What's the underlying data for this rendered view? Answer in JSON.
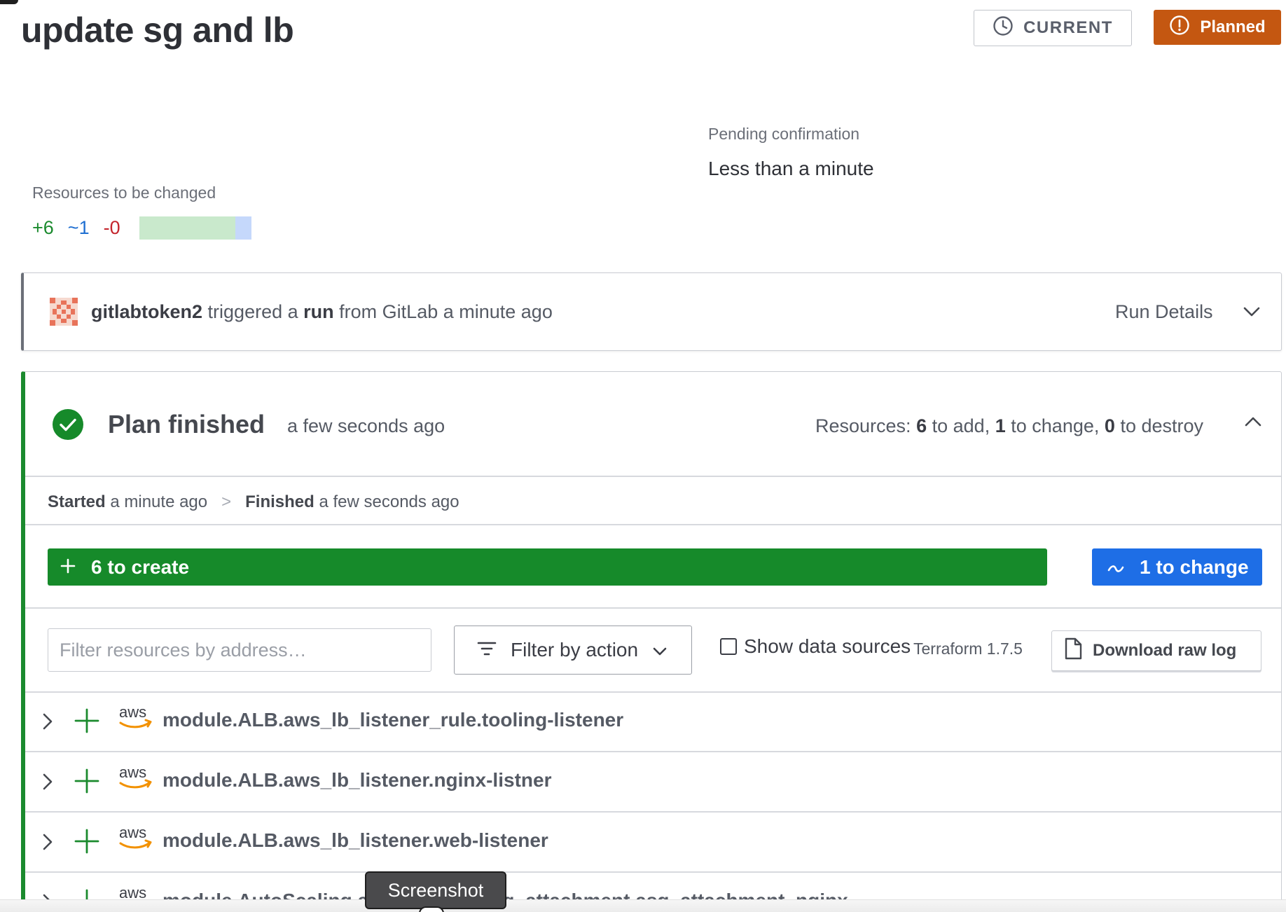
{
  "run": {
    "title": "update sg and lb",
    "current_label": "CURRENT",
    "status_label": "Planned"
  },
  "pending": {
    "label": "Pending confirmation",
    "value": "Less than a minute"
  },
  "resources_summary": {
    "label": "Resources to be changed",
    "add": "+6",
    "change": "~1",
    "destroy": "-0",
    "bar": {
      "add_fraction": 0.857,
      "change_fraction": 0.143
    }
  },
  "trigger": {
    "user": "gitlabtoken2",
    "text_1": "triggered a",
    "run_word": "run",
    "text_2": "from GitLab a minute ago",
    "details_label": "Run Details"
  },
  "plan": {
    "title": "Plan finished",
    "time": "a few seconds ago",
    "resources_prefix": "Resources:",
    "add_count": "6",
    "add_text": "to add,",
    "change_count": "1",
    "change_text": "to change,",
    "destroy_count": "0",
    "destroy_text": "to destroy",
    "started_label": "Started",
    "started_time": "a minute ago",
    "arrow": ">",
    "finished_label": "Finished",
    "finished_time": "a few seconds ago",
    "create_bar_label": "6 to create",
    "change_bar_label": "1 to change"
  },
  "filters": {
    "address_placeholder": "Filter resources by address…",
    "action_label": "Filter by action",
    "show_data_sources": "Show data sources",
    "terraform_version": "Terraform 1.7.5",
    "download_label": "Download raw log"
  },
  "resource_rows": [
    {
      "address": "module.ALB.aws_lb_listener_rule.tooling-listener"
    },
    {
      "address": "module.ALB.aws_lb_listener.nginx-listner"
    },
    {
      "address": "module.ALB.aws_lb_listener.web-listener"
    },
    {
      "address": "module.AutoScaling.aws_autoscaling_attachment.asg_attachment_nginx"
    }
  ],
  "provider_label": "aws",
  "tooltip": "Screenshot",
  "colors": {
    "add": "#1b8a2e",
    "change": "#1f6fd1",
    "destroy": "#c4262e",
    "planned": "#c45711"
  }
}
